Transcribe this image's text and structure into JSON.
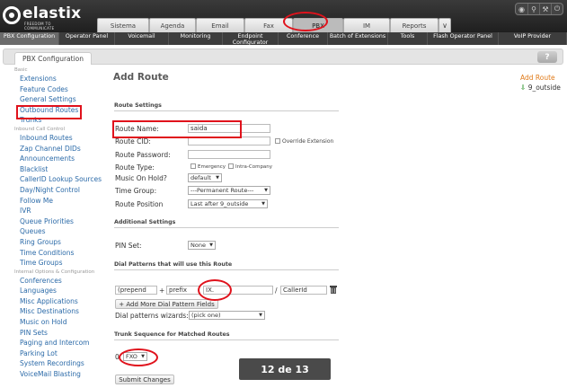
{
  "brand": {
    "name": "elastix",
    "tagline": "FREEDOM TO COMMUNICATE"
  },
  "tabs": [
    {
      "label": "Sistema",
      "width": 58
    },
    {
      "label": "Agenda",
      "width": 52
    },
    {
      "label": "Email",
      "width": 54
    },
    {
      "label": "Fax",
      "width": 54
    },
    {
      "label": "PBX",
      "width": 56,
      "active": true
    },
    {
      "label": "IM",
      "width": 52
    },
    {
      "label": "Reports",
      "width": 54
    }
  ],
  "tab_more_icon": "chevron-down-icon",
  "tools": [
    "drop-icon",
    "search-icon",
    "tools-icon",
    "power-icon"
  ],
  "subnav": [
    {
      "label": "PBX Configuration",
      "w": 66,
      "active": true
    },
    {
      "label": "Operator Panel",
      "w": 62
    },
    {
      "label": "Voicemail",
      "w": 60
    },
    {
      "label": "Monitoring",
      "w": 60
    },
    {
      "label": "Endpoint Configurator",
      "w": 62
    },
    {
      "label": "Conference",
      "w": 55
    },
    {
      "label": "Batch of Extensions",
      "w": 67
    },
    {
      "label": "Tools",
      "w": 44
    },
    {
      "label": "Flash Operator Panel",
      "w": 79
    },
    {
      "label": "VoIP Provider",
      "w": 76
    }
  ],
  "module": {
    "tab_label": "PBX Configuration",
    "help_label": "?"
  },
  "sidebar": [
    {
      "section": "Basic"
    },
    {
      "label": "Extensions"
    },
    {
      "label": "Feature Codes"
    },
    {
      "label": "General Settings"
    },
    {
      "label": "Outbound Routes"
    },
    {
      "label": "Trunks"
    },
    {
      "section": "Inbound Call Control"
    },
    {
      "label": "Inbound Routes"
    },
    {
      "label": "Zap Channel DIDs"
    },
    {
      "label": "Announcements"
    },
    {
      "label": "Blacklist"
    },
    {
      "label": "CallerID Lookup Sources"
    },
    {
      "label": "Day/Night Control"
    },
    {
      "label": "Follow Me"
    },
    {
      "label": "IVR"
    },
    {
      "label": "Queue Priorities"
    },
    {
      "label": "Queues"
    },
    {
      "label": "Ring Groups"
    },
    {
      "label": "Time Conditions"
    },
    {
      "label": "Time Groups"
    },
    {
      "section": "Internal Options & Configuration"
    },
    {
      "label": "Conferences"
    },
    {
      "label": "Languages"
    },
    {
      "label": "Misc Applications"
    },
    {
      "label": "Misc Destinations"
    },
    {
      "label": "Music on Hold"
    },
    {
      "label": "PIN Sets"
    },
    {
      "label": "Paging and Intercom"
    },
    {
      "label": "Parking Lot"
    },
    {
      "label": "System Recordings"
    },
    {
      "label": "VoiceMail Blasting"
    }
  ],
  "main": {
    "title": "Add Route",
    "route_settings_hdr": "Route Settings",
    "route_name_label": "Route Name:",
    "route_name_value": "saida",
    "route_cid_label": "Route CID:",
    "route_cid_value": "",
    "override_extension_label": "Override Extension",
    "route_password_label": "Route Password:",
    "route_password_value": "",
    "route_type_label": "Route Type:",
    "emergency_label": "Emergency",
    "intra_company_label": "Intra-Company",
    "music_on_hold_label": "Music On Hold?",
    "music_on_hold_value": "default",
    "time_group_label": "Time Group:",
    "time_group_value": "---Permanent Route---",
    "route_position_label": "Route Position",
    "route_position_value": "Last after 9_outside",
    "additional_settings_hdr": "Additional Settings",
    "pin_set_label": "PIN Set:",
    "pin_set_value": "None",
    "dial_patterns_hdr": "Dial Patterns that will use this Route",
    "prepend_value": "(prepend",
    "plus_sign": "+",
    "prefix_value": "prefix",
    "pattern_value": "IX.",
    "slash_sign": "/",
    "callerid_value": "CallerId",
    "add_more_label": "+ Add More Dial Pattern Fields",
    "wizard_label": "Dial patterns wizards:",
    "wizard_value": "(pick one)",
    "trunk_seq_hdr": "Trunk Sequence for Matched Routes",
    "trunk_index": "0",
    "trunk_value": "FXO",
    "submit_label": "Submit Changes"
  },
  "right_panel": {
    "add_route_label": "Add Route",
    "route_label": "9_outside"
  },
  "pager": {
    "text": "12 de 13"
  },
  "colors": {
    "highlight": "#e0121c",
    "link": "#2b6aa8",
    "accent": "#e07b1a"
  }
}
